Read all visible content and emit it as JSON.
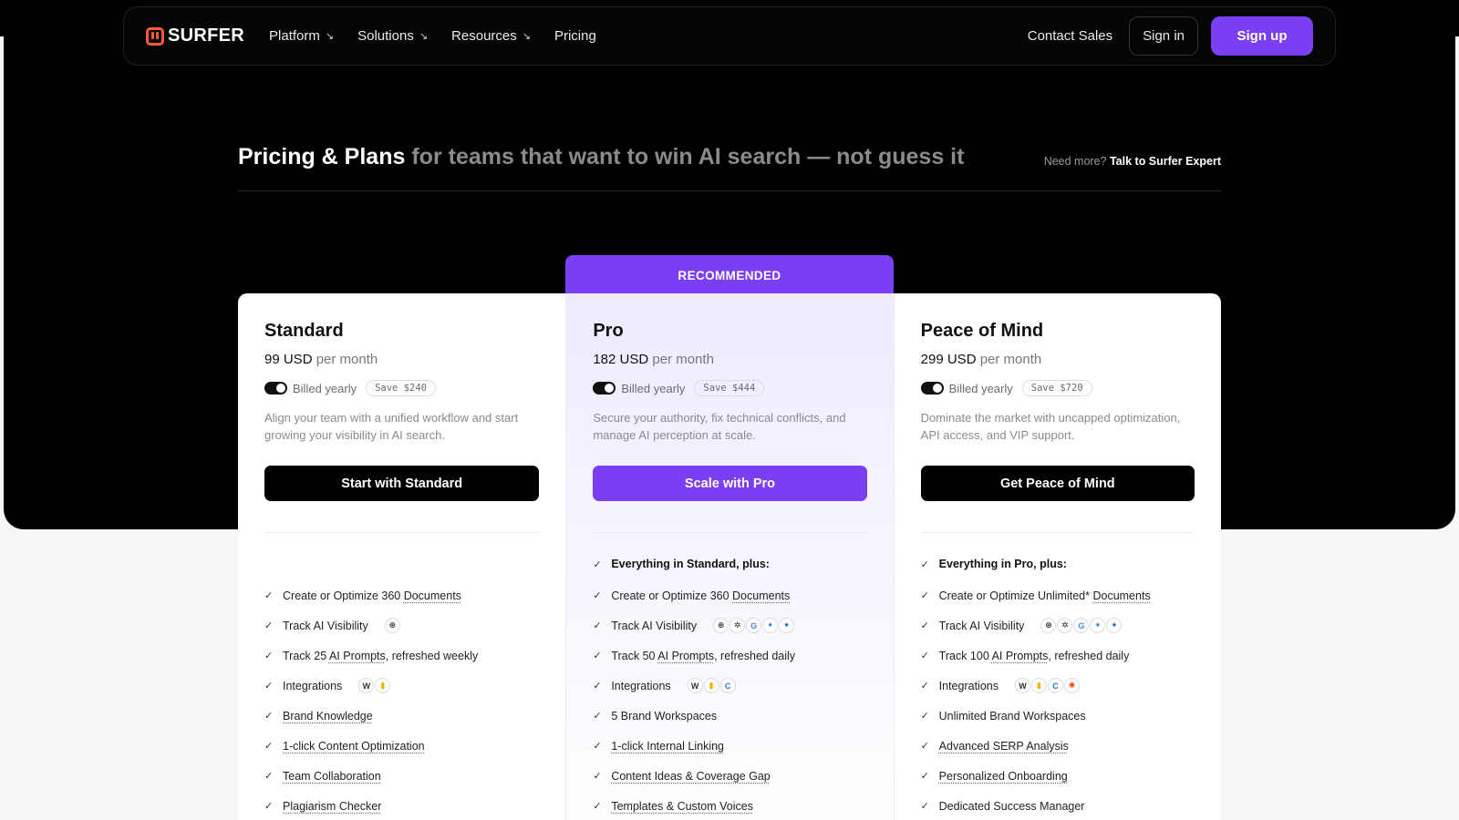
{
  "nav": {
    "logo": "SURFER",
    "links": [
      {
        "label": "Platform",
        "arrow": "↘"
      },
      {
        "label": "Solutions",
        "arrow": "↘"
      },
      {
        "label": "Resources",
        "arrow": "↘"
      },
      {
        "label": "Pricing",
        "arrow": ""
      }
    ],
    "contact": "Contact Sales",
    "signin": "Sign in",
    "signup": "Sign up",
    "accent": "#7a3ff2"
  },
  "header": {
    "title": "Pricing & Plans",
    "subtitle": "for teams that want to win AI search — not guess it",
    "need_more": "Need more?",
    "expert_link": "Talk to Surfer Expert"
  },
  "recommended": "RECOMMENDED",
  "plans": [
    {
      "name": "Standard",
      "price": "99 USD",
      "per": "per month",
      "billing": "Billed yearly",
      "save": "Save $240",
      "desc": "Align your team with a unified workflow and start growing your visibility in AI search.",
      "cta": "Start with Standard",
      "head": "",
      "features": [
        {
          "pre": "Create or Optimize 360 ",
          "link": "Documents",
          "post": "",
          "icons": []
        },
        {
          "pre": "Track AI Visibility",
          "link": "",
          "post": "",
          "icons": [
            "openai-icon"
          ]
        },
        {
          "pre": "Track 25 ",
          "link": "AI Prompts",
          "post": ", refreshed weekly",
          "icons": []
        },
        {
          "pre": "Integrations",
          "link": "",
          "post": "",
          "icons": [
            "wordpress-icon",
            "google-docs-icon"
          ]
        },
        {
          "pre": "",
          "link": "Brand Knowledge",
          "post": "",
          "icons": []
        },
        {
          "pre": "",
          "link": "1-click Content Optimization",
          "post": "",
          "icons": []
        },
        {
          "pre": "",
          "link": "Team Collaboration",
          "post": "",
          "icons": []
        },
        {
          "pre": "",
          "link": "Plagiarism Checker",
          "post": "",
          "icons": []
        }
      ]
    },
    {
      "name": "Pro",
      "price": "182 USD",
      "per": "per month",
      "billing": "Billed yearly",
      "save": "Save $444",
      "desc": "Secure your authority, fix technical conflicts, and manage AI perception at scale.",
      "cta": "Scale with Pro",
      "head": "Everything in Standard, plus:",
      "features": [
        {
          "pre": "Create or Optimize 360 ",
          "link": "Documents",
          "post": "",
          "icons": []
        },
        {
          "pre": "Track AI Visibility",
          "link": "",
          "post": "",
          "icons": [
            "openai-icon",
            "perplexity-icon",
            "google-icon",
            "gemini-icon",
            "copilot-icon"
          ]
        },
        {
          "pre": "Track 50 ",
          "link": "AI Prompts",
          "post": ", refreshed daily",
          "icons": []
        },
        {
          "pre": "Integrations",
          "link": "",
          "post": "",
          "icons": [
            "wordpress-icon",
            "google-docs-icon",
            "contentful-icon"
          ]
        },
        {
          "pre": "5 Brand Workspaces",
          "link": "",
          "post": "",
          "icons": []
        },
        {
          "pre": "",
          "link": "1-click Internal Linking",
          "post": "",
          "icons": []
        },
        {
          "pre": "",
          "link": "Content Ideas & Coverage Gap",
          "post": "",
          "icons": []
        },
        {
          "pre": "",
          "link": "Templates & Custom Voices",
          "post": "",
          "icons": []
        }
      ]
    },
    {
      "name": "Peace of Mind",
      "price": "299 USD",
      "per": "per month",
      "billing": "Billed yearly",
      "save": "Save $720",
      "desc": "Dominate the market with uncapped optimization, API access, and VIP support.",
      "cta": "Get Peace of Mind",
      "head": "Everything in Pro, plus:",
      "features": [
        {
          "pre": "Create or Optimize Unlimited* ",
          "link": "Documents",
          "post": "",
          "icons": []
        },
        {
          "pre": "Track AI Visibility",
          "link": "",
          "post": "",
          "icons": [
            "openai-icon",
            "perplexity-icon",
            "google-icon",
            "gemini-icon",
            "copilot-icon"
          ]
        },
        {
          "pre": "Track 100 ",
          "link": "AI Prompts",
          "post": ", refreshed daily",
          "icons": []
        },
        {
          "pre": "Integrations",
          "link": "",
          "post": "",
          "icons": [
            "wordpress-icon",
            "google-docs-icon",
            "contentful-icon",
            "zapier-icon"
          ]
        },
        {
          "pre": "Unlimited Brand Workspaces",
          "link": "",
          "post": "",
          "icons": []
        },
        {
          "pre": "",
          "link": "Advanced SERP Analysis",
          "post": "",
          "icons": []
        },
        {
          "pre": "",
          "link": "Personalized Onboarding",
          "post": "",
          "icons": []
        },
        {
          "pre": "Dedicated Success Manager",
          "link": "",
          "post": "",
          "icons": []
        }
      ]
    }
  ]
}
